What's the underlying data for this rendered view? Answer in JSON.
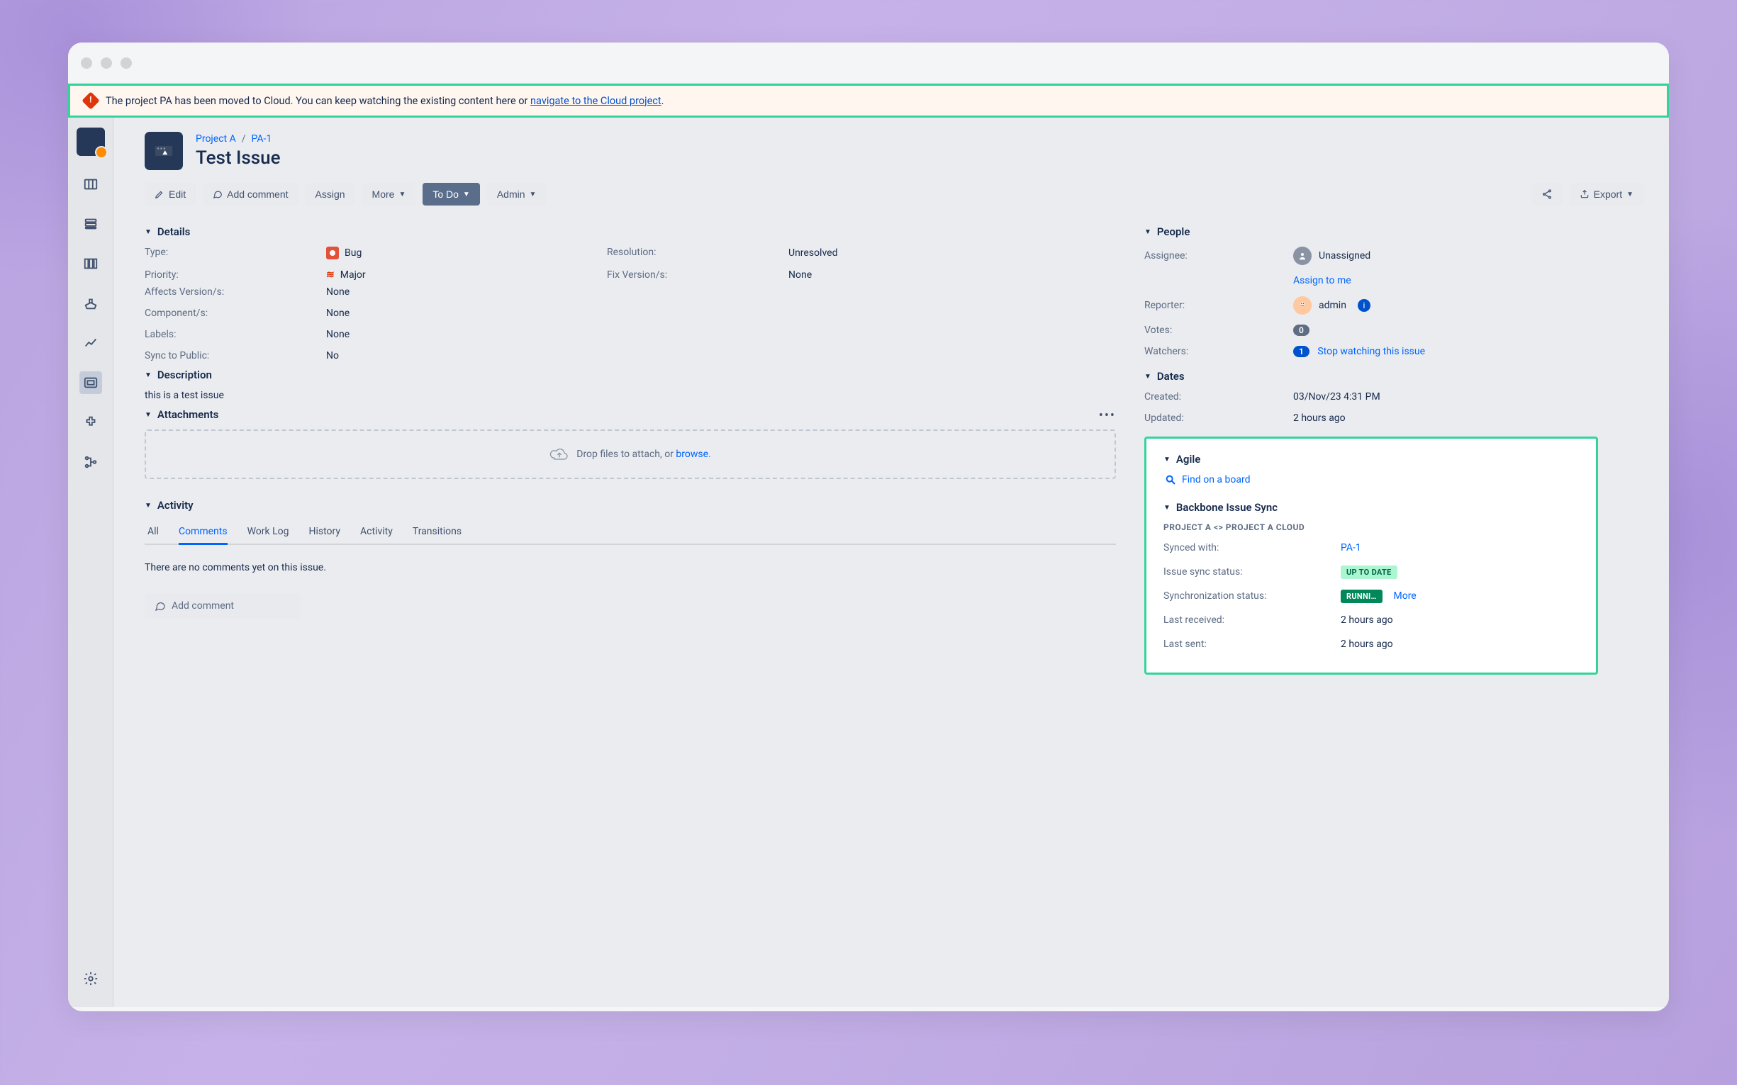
{
  "banner": {
    "text_prefix": "The project PA has been moved to Cloud. You can keep watching the existing content here or ",
    "link_text": "navigate to the Cloud project",
    "text_suffix": "."
  },
  "breadcrumb": {
    "project": "Project A",
    "issue_key": "PA-1",
    "sep": "/"
  },
  "issue_title": "Test Issue",
  "toolbar": {
    "edit": "Edit",
    "add_comment": "Add comment",
    "assign": "Assign",
    "more": "More",
    "status": "To Do",
    "admin": "Admin",
    "export": "Export"
  },
  "sections": {
    "details": "Details",
    "description": "Description",
    "attachments": "Attachments",
    "activity": "Activity",
    "people": "People",
    "dates": "Dates",
    "agile": "Agile",
    "backbone": "Backbone Issue Sync"
  },
  "details": {
    "type_label": "Type:",
    "type_value": "Bug",
    "priority_label": "Priority:",
    "priority_value": "Major",
    "affects_label": "Affects Version/s:",
    "affects_value": "None",
    "components_label": "Component/s:",
    "components_value": "None",
    "labels_label": "Labels:",
    "labels_value": "None",
    "sync_label": "Sync to Public:",
    "sync_value": "No",
    "resolution_label": "Resolution:",
    "resolution_value": "Unresolved",
    "fixversion_label": "Fix Version/s:",
    "fixversion_value": "None"
  },
  "description_text": "this is a test issue",
  "attachments": {
    "drop_prefix": "Drop files to attach, or ",
    "browse": "browse",
    "drop_suffix": "."
  },
  "activity": {
    "tabs": {
      "all": "All",
      "comments": "Comments",
      "worklog": "Work Log",
      "history": "History",
      "activity": "Activity",
      "transitions": "Transitions"
    },
    "empty": "There are no comments yet on this issue.",
    "add_comment": "Add comment"
  },
  "people": {
    "assignee_label": "Assignee:",
    "assignee_value": "Unassigned",
    "assign_to_me": "Assign to me",
    "reporter_label": "Reporter:",
    "reporter_value": "admin",
    "votes_label": "Votes:",
    "votes_value": "0",
    "watchers_label": "Watchers:",
    "watchers_value": "1",
    "stop_watching": "Stop watching this issue"
  },
  "dates": {
    "created_label": "Created:",
    "created_value": "03/Nov/23 4:31 PM",
    "updated_label": "Updated:",
    "updated_value": "2 hours ago"
  },
  "agile": {
    "find_board": "Find on a board"
  },
  "backbone": {
    "heading": "PROJECT A <> PROJECT A CLOUD",
    "synced_with_label": "Synced with:",
    "synced_with_value": "PA-1",
    "issue_sync_label": "Issue sync status:",
    "issue_sync_value": "UP TO DATE",
    "sync_status_label": "Synchronization status:",
    "sync_status_value": "RUNNI…",
    "more": "More",
    "last_received_label": "Last received:",
    "last_received_value": "2 hours ago",
    "last_sent_label": "Last sent:",
    "last_sent_value": "2 hours ago"
  }
}
